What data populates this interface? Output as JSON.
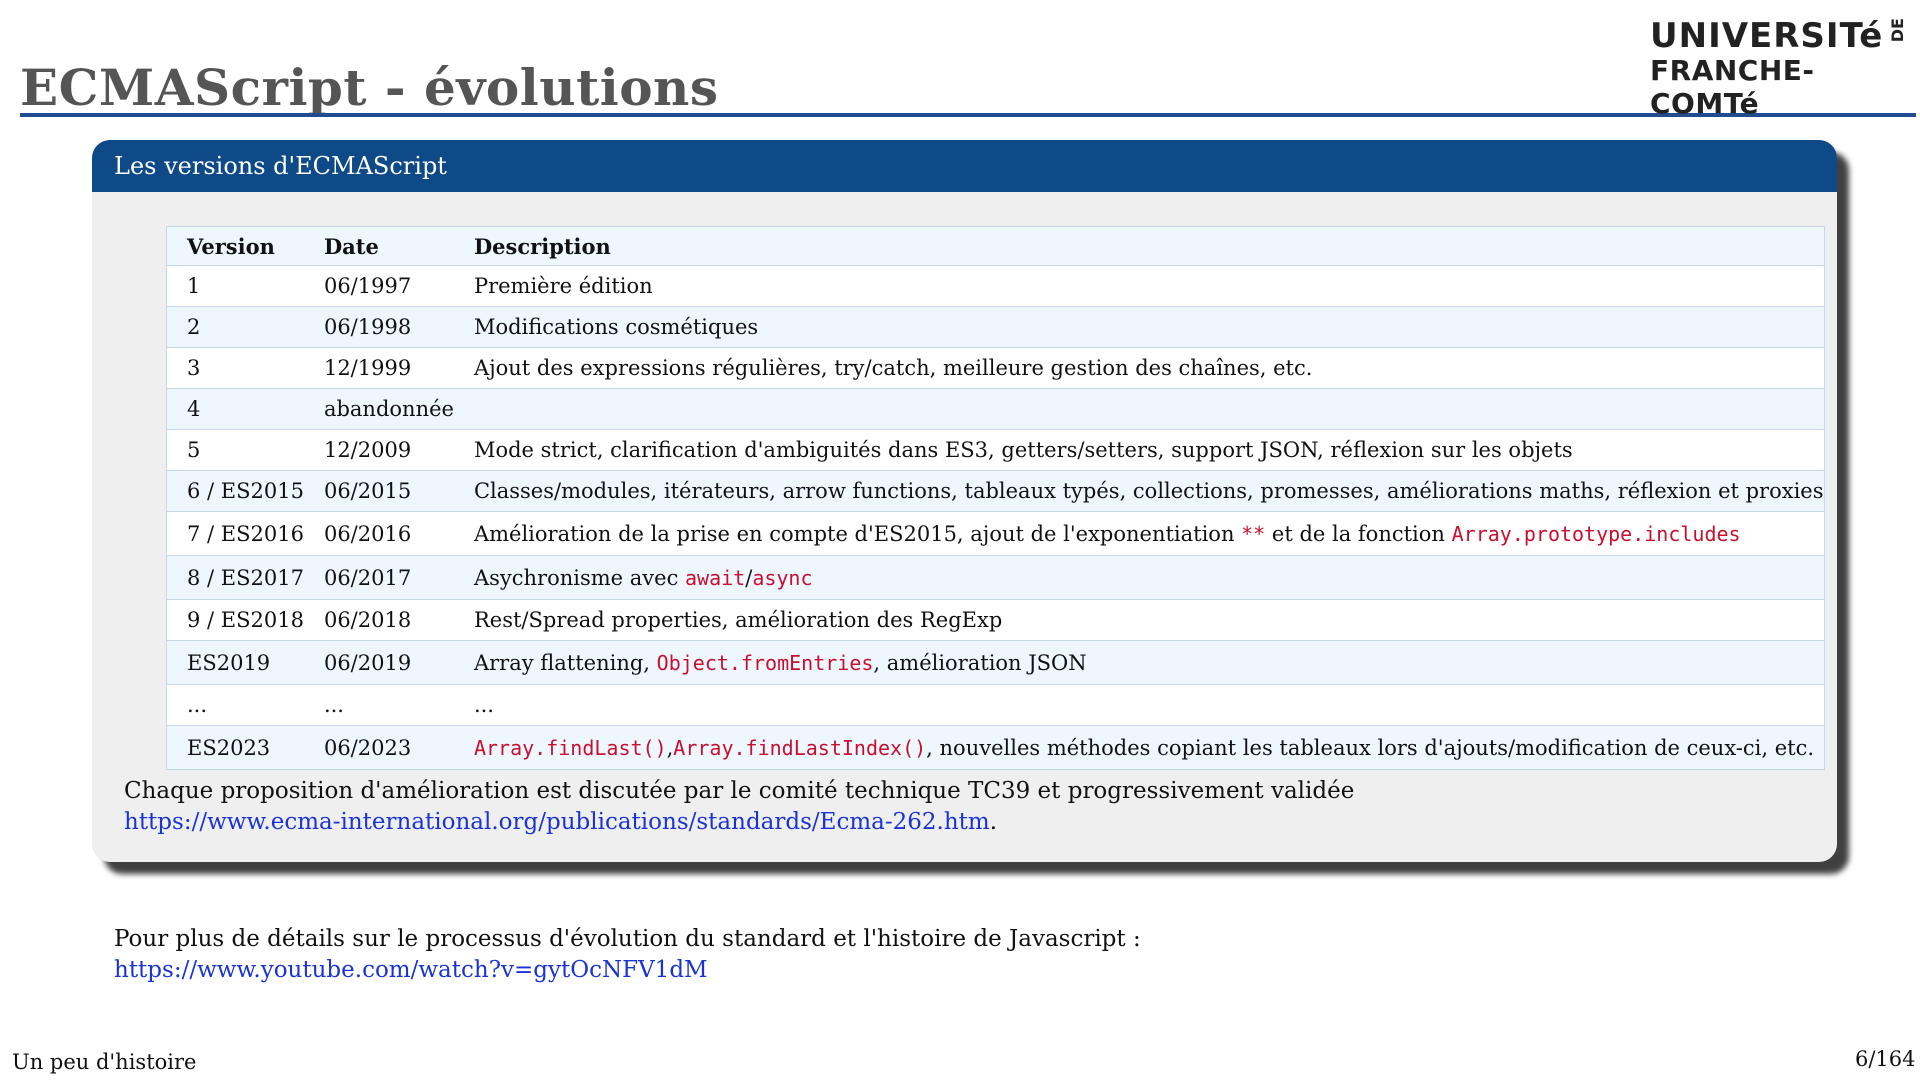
{
  "slide": {
    "title": "ECMAScript - évolutions",
    "footer_left": "Un peu d'histoire",
    "page": "6/164"
  },
  "logo": {
    "line1": "UNIVERSITé",
    "de": "DE",
    "line2": "FRANCHE-COMTé",
    "accent_color": "#d1222a"
  },
  "block": {
    "header": "Les versions d'ECMAScript",
    "header_color": "#0e4988",
    "table": {
      "headers": [
        "Version",
        "Date",
        "Description"
      ],
      "rows": [
        {
          "version": "1",
          "date": "06/1997",
          "description": "Première édition"
        },
        {
          "version": "2",
          "date": "06/1998",
          "description": "Modifications cosmétiques"
        },
        {
          "version": "3",
          "date": "12/1999",
          "description": "Ajout des expressions régulières, try/catch, meilleure gestion des chaînes, etc."
        },
        {
          "version": "4",
          "date": "abandonnée",
          "description": ""
        },
        {
          "version": "5",
          "date": "12/2009",
          "description": "Mode strict, clarification d'ambiguités dans ES3, getters/setters, support JSON, réflexion sur les objets"
        },
        {
          "version": "6 / ES2015",
          "date": "06/2015",
          "description": "Classes/modules, itérateurs, arrow functions, tableaux typés, collections, promesses, améliorations maths, réflexion et proxies"
        },
        {
          "version": "7 / ES2016",
          "date": "06/2016",
          "desc_a": "Amélioration de la prise en compte d'ES2015, ajout de l'exponentiation ",
          "code_a": "**",
          "desc_b": " et de la fonction ",
          "code_b": "Array.prototype.includes"
        },
        {
          "version": "8 / ES2017",
          "date": "06/2017",
          "desc_a": "Asychronisme avec ",
          "code_a": "await",
          "desc_b": "/",
          "code_b": "async"
        },
        {
          "version": "9 / ES2018",
          "date": "06/2018",
          "description": "Rest/Spread properties, amélioration des RegExp"
        },
        {
          "version": "ES2019",
          "date": "06/2019",
          "desc_a": "Array flattening, ",
          "code_a": "Object.fromEntries",
          "desc_b": ", amélioration JSON"
        },
        {
          "version": "...",
          "date": "...",
          "description": "..."
        },
        {
          "version": "ES2023",
          "date": "06/2023",
          "code_a": "Array.findLast()",
          "desc_a": ",",
          "code_b": "Array.findLastIndex()",
          "desc_b": ", nouvelles méthodes copiant les tableaux lors d'ajouts/modification de ceux-ci, etc."
        }
      ]
    },
    "note_text": "Chaque proposition d'amélioration est discutée par le comité technique TC39 et progressivement validée",
    "note_link": "https://www.ecma-international.org/publications/standards/Ecma-262.htm",
    "note_end": "."
  },
  "details": {
    "text": "Pour plus de détails sur le processus d'évolution du standard et l'histoire de Javascript :",
    "link": "https://www.youtube.com/watch?v=gytOcNFV1dM"
  },
  "colors": {
    "title_rule": "#1f4d8f",
    "code": "#c8102e",
    "link": "#1a33d6"
  }
}
